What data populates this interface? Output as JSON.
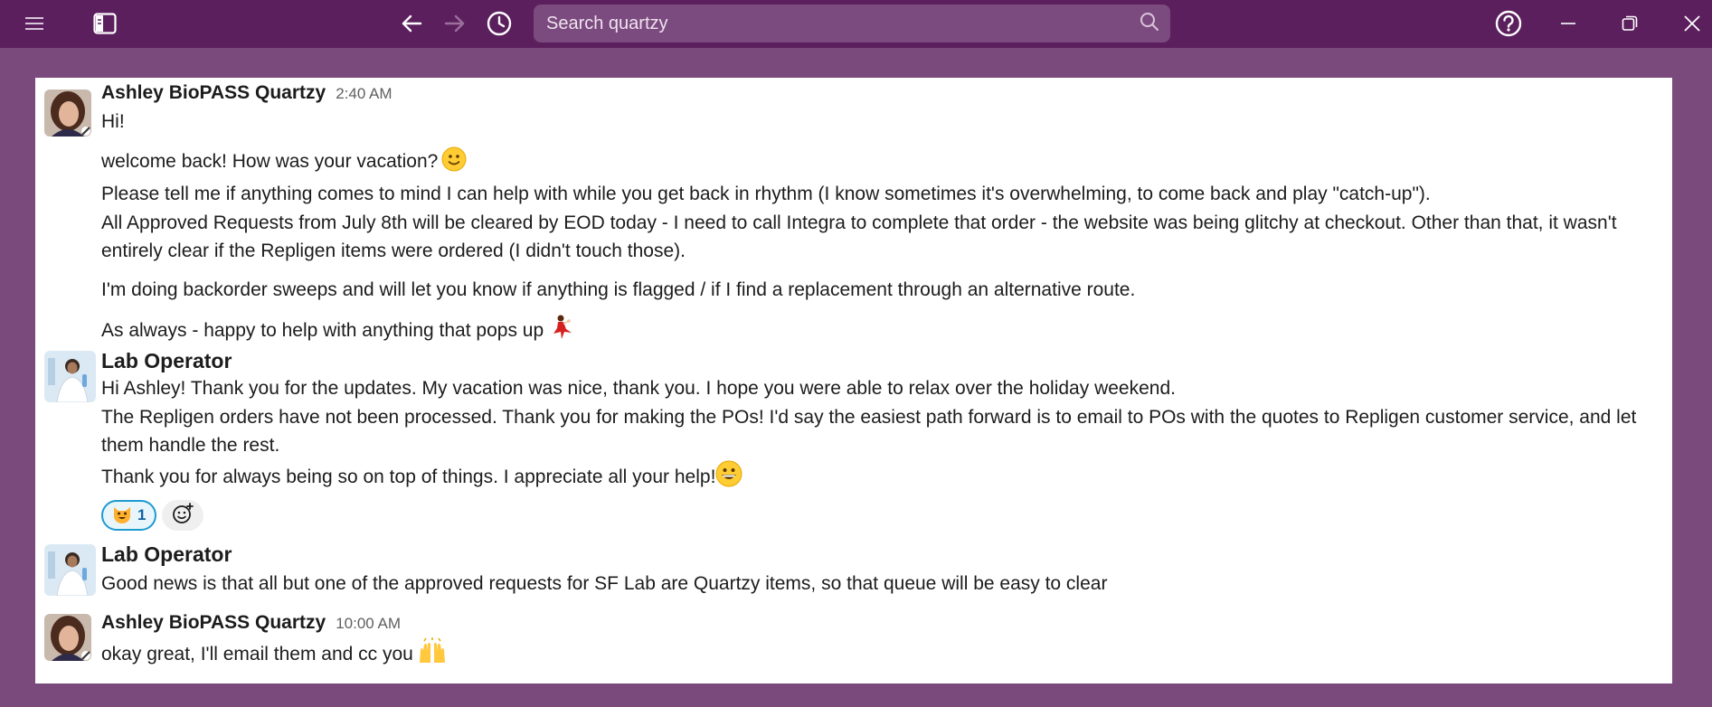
{
  "toolbar": {
    "search_placeholder": "Search quartzy"
  },
  "messages": [
    {
      "author": "Ashley BioPASS Quartzy",
      "time": "2:40 AM",
      "lines": [
        "Hi!",
        "welcome back! How was your vacation?",
        "Please tell me if anything comes to mind I can help with while you get back in rhythm (I know sometimes it's overwhelming, to come back and play \"catch-up\").",
        "All Approved Requests from July 8th will be cleared by EOD today - I need to call Integra to complete that order - the website was being glitchy at checkout. Other than that, it wasn't",
        "entirely clear if the Repligen items were ordered (I didn't touch those).",
        "I'm doing backorder sweeps and will let you know if anything is flagged / if I find a replacement through an alternative route.",
        "As always - happy to help with anything that pops up"
      ]
    },
    {
      "author": "Lab Operator",
      "lines": [
        "Hi Ashley! Thank you for the updates. My vacation was nice, thank you. I hope you were able to relax over the holiday weekend.",
        "The Repligen orders have not been processed. Thank you for making the POs! I'd say the easiest path forward is to email to POs with the quotes to Repligen customer service, and let",
        "them handle the rest.",
        "Thank you for always being so on top of things. I appreciate all your help!"
      ],
      "reactions": [
        {
          "emoji": "smiley-cat",
          "count": "1"
        }
      ]
    },
    {
      "author": "Lab Operator",
      "lines": [
        "Good news is that all but one of the approved requests for SF Lab are Quartzy items, so that queue will be easy to clear"
      ]
    },
    {
      "author": "Ashley BioPASS Quartzy",
      "time": "10:00 AM",
      "lines": [
        "okay great, I'll email them and cc you"
      ]
    }
  ],
  "colors": {
    "titlebar": "#5c1f5e",
    "background": "#7a4a7c",
    "search": "#7b4a7e",
    "reaction_border": "#1d9bd1"
  }
}
